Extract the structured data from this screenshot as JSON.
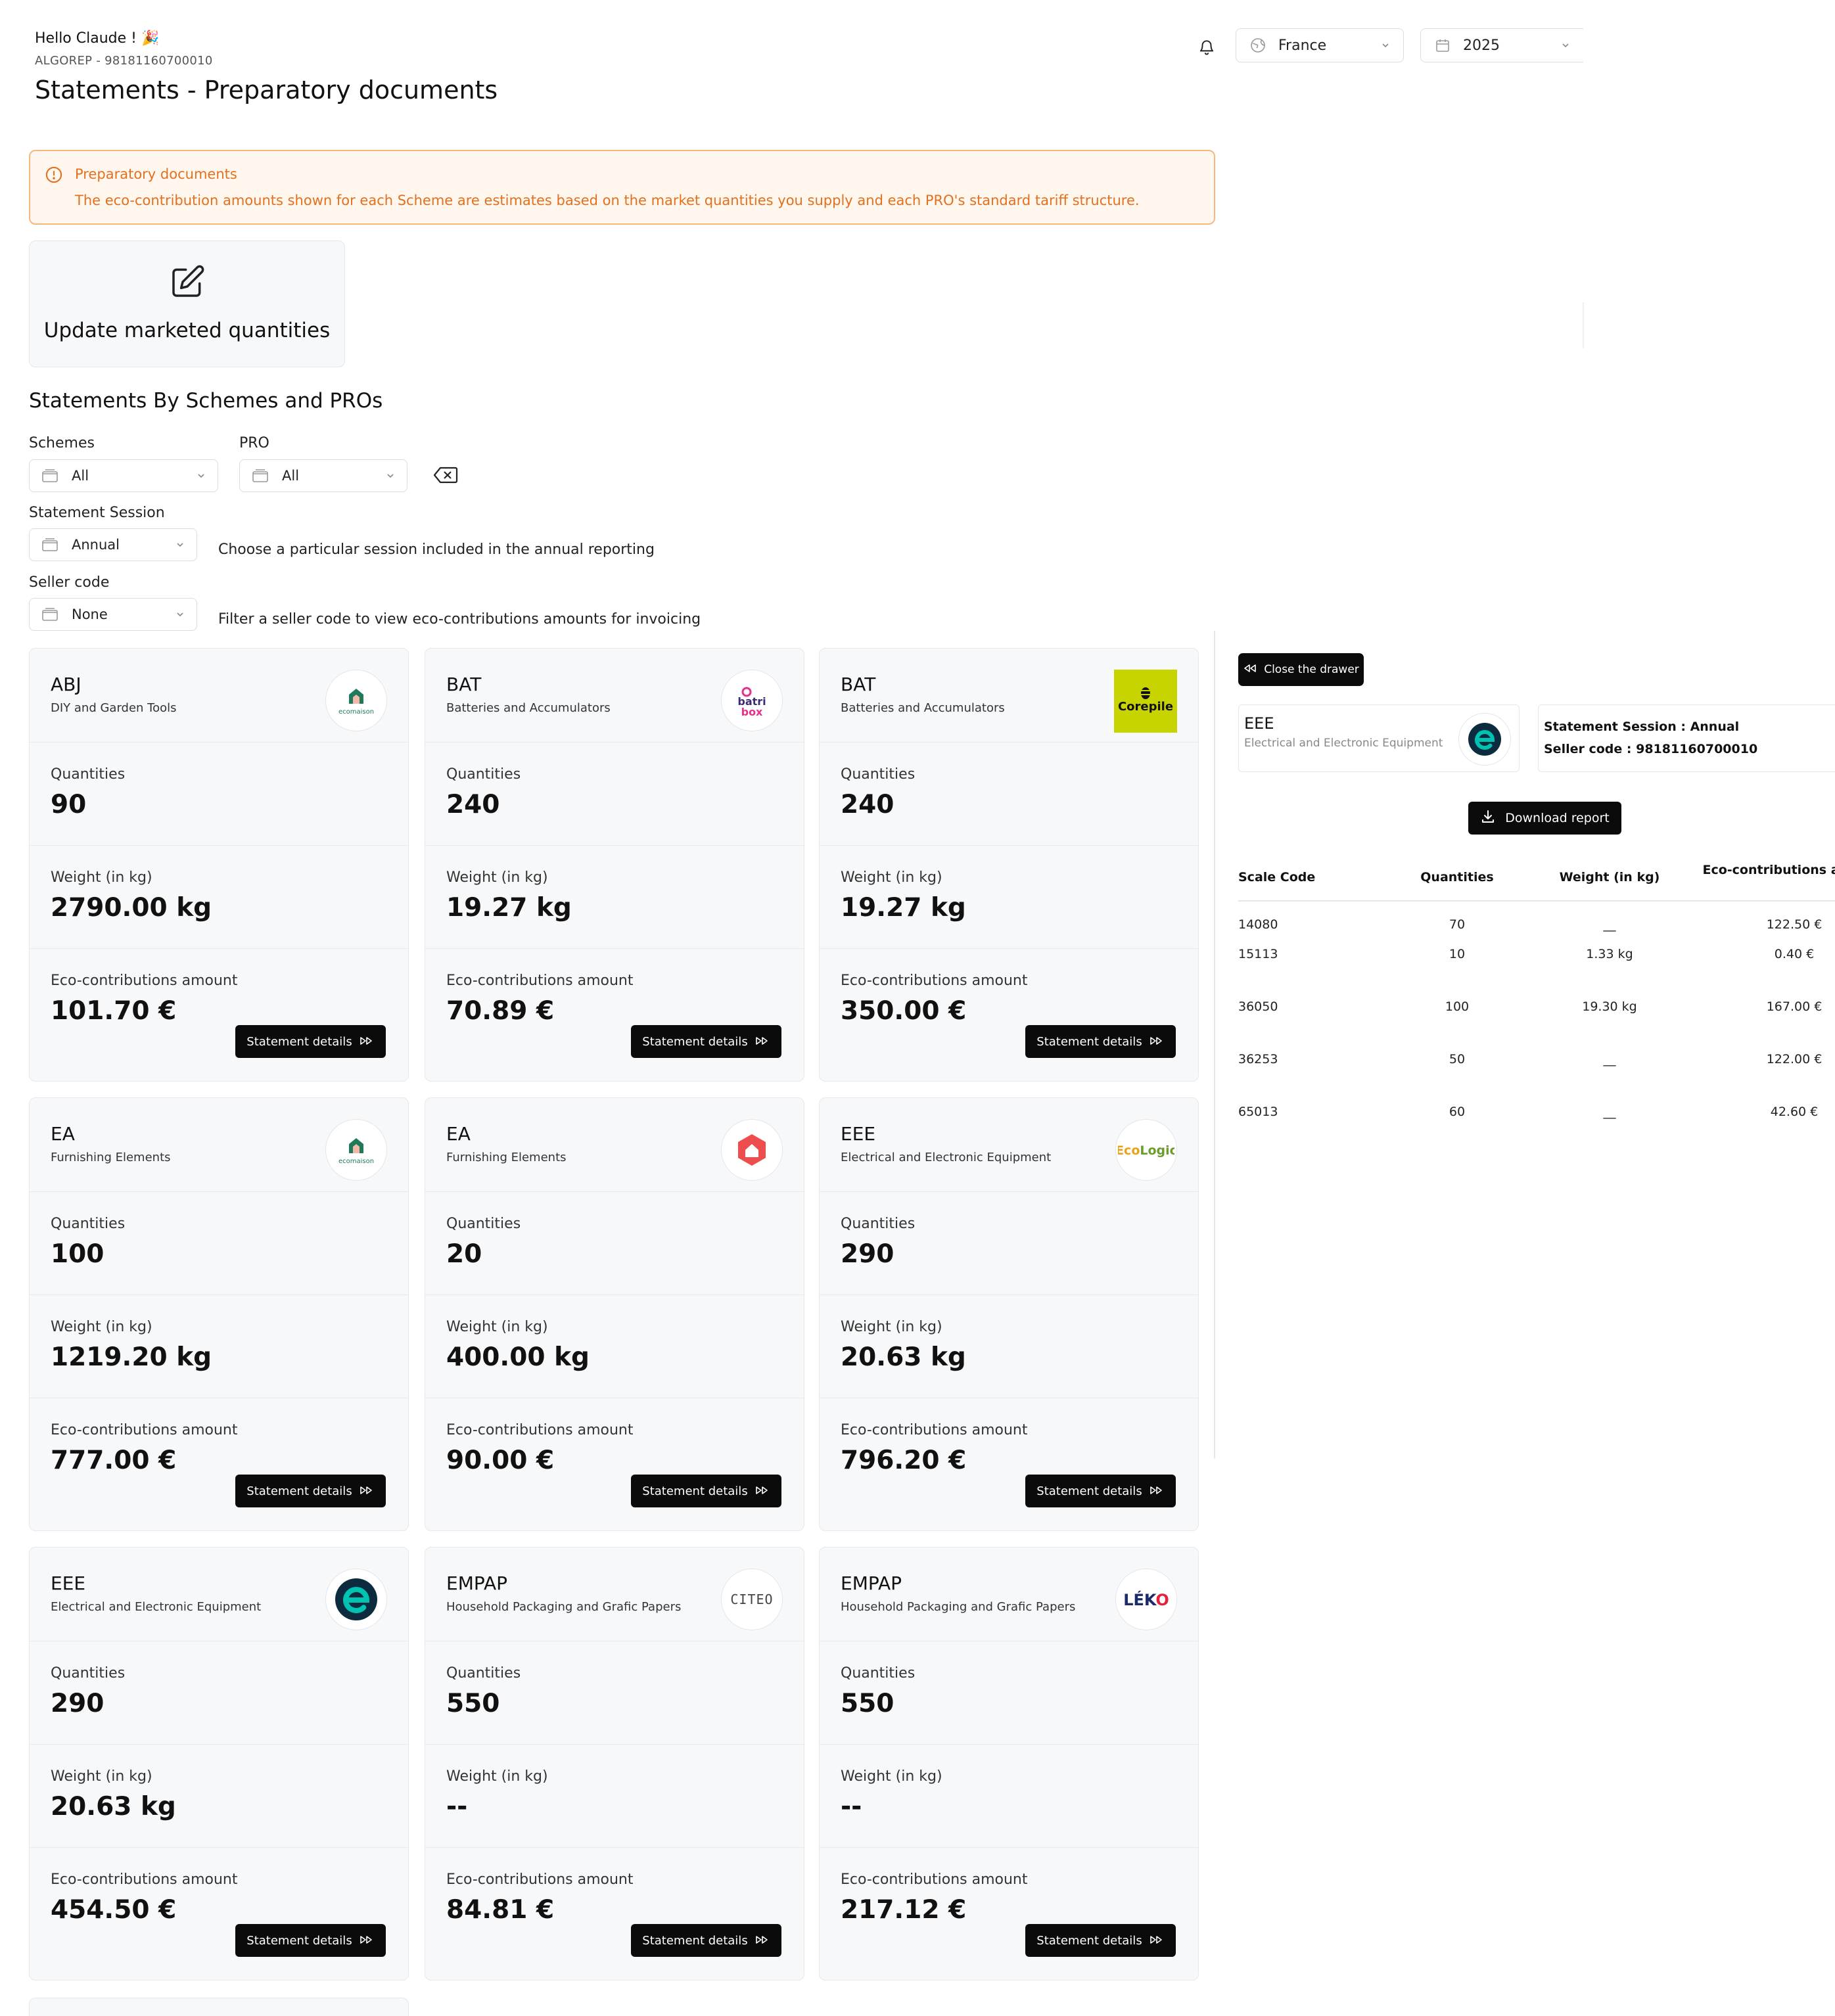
{
  "header": {
    "greeting": "Hello Claude ! 🎉",
    "account": "ALGOREP - 98181160700010",
    "title": "Statements - Preparatory documents",
    "country": "France",
    "year": "2025"
  },
  "alert": {
    "title": "Preparatory documents",
    "body": "The eco-contribution amounts shown for each Scheme are estimates based on the market quantities you supply and each PRO's standard tariff structure."
  },
  "update_card": {
    "label": "Update marketed quantities"
  },
  "section_title": "Statements By Schemes and PROs",
  "filters": {
    "schemes_label": "Schemes",
    "schemes_value": "All",
    "pro_label": "PRO",
    "pro_value": "All",
    "session_label": "Statement Session",
    "session_value": "Annual",
    "session_hint": "Choose a particular session included in the annual reporting",
    "seller_label": "Seller code",
    "seller_value": "None",
    "seller_hint": "Filter a seller code to view eco-contributions amounts for invoicing"
  },
  "card_labels": {
    "quantities": "Quantities",
    "weight": "Weight (in kg)",
    "amount": "Eco-contributions amount",
    "details_button": "Statement details"
  },
  "cards": [
    {
      "scheme": "ABJ",
      "description": "DIY and Garden Tools",
      "logo": "ecomaison-logo",
      "logo_text": "ecomaison",
      "quantities": "90",
      "weight": "2790.00 kg",
      "amount": "101.70 €"
    },
    {
      "scheme": "BAT",
      "description": "Batteries and Accumulators",
      "logo": "batribox-logo",
      "logo_text": "batri box",
      "quantities": "240",
      "weight": "19.27 kg",
      "amount": "70.89 €"
    },
    {
      "scheme": "BAT",
      "description": "Batteries and Accumulators",
      "logo": "corepile-logo",
      "logo_text": "Corepile",
      "quantities": "240",
      "weight": "19.27 kg",
      "amount": "350.00 €"
    },
    {
      "scheme": "EA",
      "description": "Furnishing Elements",
      "logo": "ecomaison-logo",
      "logo_text": "ecomaison",
      "quantities": "100",
      "weight": "1219.20 kg",
      "amount": "777.00 €"
    },
    {
      "scheme": "EA",
      "description": "Furnishing Elements",
      "logo": "house-hexagon-logo",
      "quantities": "20",
      "weight": "400.00 kg",
      "amount": "90.00 €"
    },
    {
      "scheme": "EEE",
      "description": "Electrical and Electronic Equipment",
      "logo": "ecologic-logo",
      "logo_text": "EcoLogic",
      "quantities": "290",
      "weight": "20.63 kg",
      "amount": "796.20 €"
    },
    {
      "scheme": "EEE",
      "description": "Electrical and Electronic Equipment",
      "logo": "ecosystem-e-logo",
      "quantities": "290",
      "weight": "20.63 kg",
      "amount": "454.50 €"
    },
    {
      "scheme": "EMPAP",
      "description": "Household Packaging and Grafic Papers",
      "logo": "citeo-logo",
      "logo_text": "CITEO",
      "quantities": "550",
      "weight": "--",
      "amount": "84.81 €"
    },
    {
      "scheme": "EMPAP",
      "description": "Household Packaging and Grafic Papers",
      "logo": "leko-logo",
      "logo_text": "LÉKO",
      "quantities": "550",
      "weight": "--",
      "amount": "217.12 €"
    }
  ],
  "drawer": {
    "close_label": "Close the drawer",
    "scheme": "EEE",
    "scheme_description": "Electrical and Electronic Equipment",
    "logo": "ecosystem-e-logo",
    "session": "Statement Session : Annual",
    "seller": "Seller code : 98181160700010",
    "download_label": "Download report",
    "table": {
      "headers": {
        "scale_code": "Scale Code",
        "quantities": "Quantities",
        "weight": "Weight (in kg)",
        "amount": "Eco-contributions amount"
      },
      "rows": [
        {
          "code": "14080",
          "quantities": "70",
          "weight": "__",
          "amount": "122.50 €"
        },
        {
          "code": "15113",
          "quantities": "10",
          "weight": "1.33 kg",
          "amount": "0.40 €"
        },
        {
          "code": "36050",
          "quantities": "100",
          "weight": "19.30 kg",
          "amount": "167.00 €"
        },
        {
          "code": "36253",
          "quantities": "50",
          "weight": "__",
          "amount": "122.00 €"
        },
        {
          "code": "65013",
          "quantities": "60",
          "weight": "__",
          "amount": "42.60 €"
        }
      ]
    }
  },
  "colors": {
    "alert_text": "#e2701f",
    "alert_bg": "#fff7ee",
    "alert_border": "#f5b780",
    "button_bg": "#0b0b0b",
    "card_bg": "#f7f8fa",
    "corepile_yellow": "#c8d400",
    "ecomaison_green": "#1f7a5c",
    "ecosystem_teal": "#00a99d"
  }
}
